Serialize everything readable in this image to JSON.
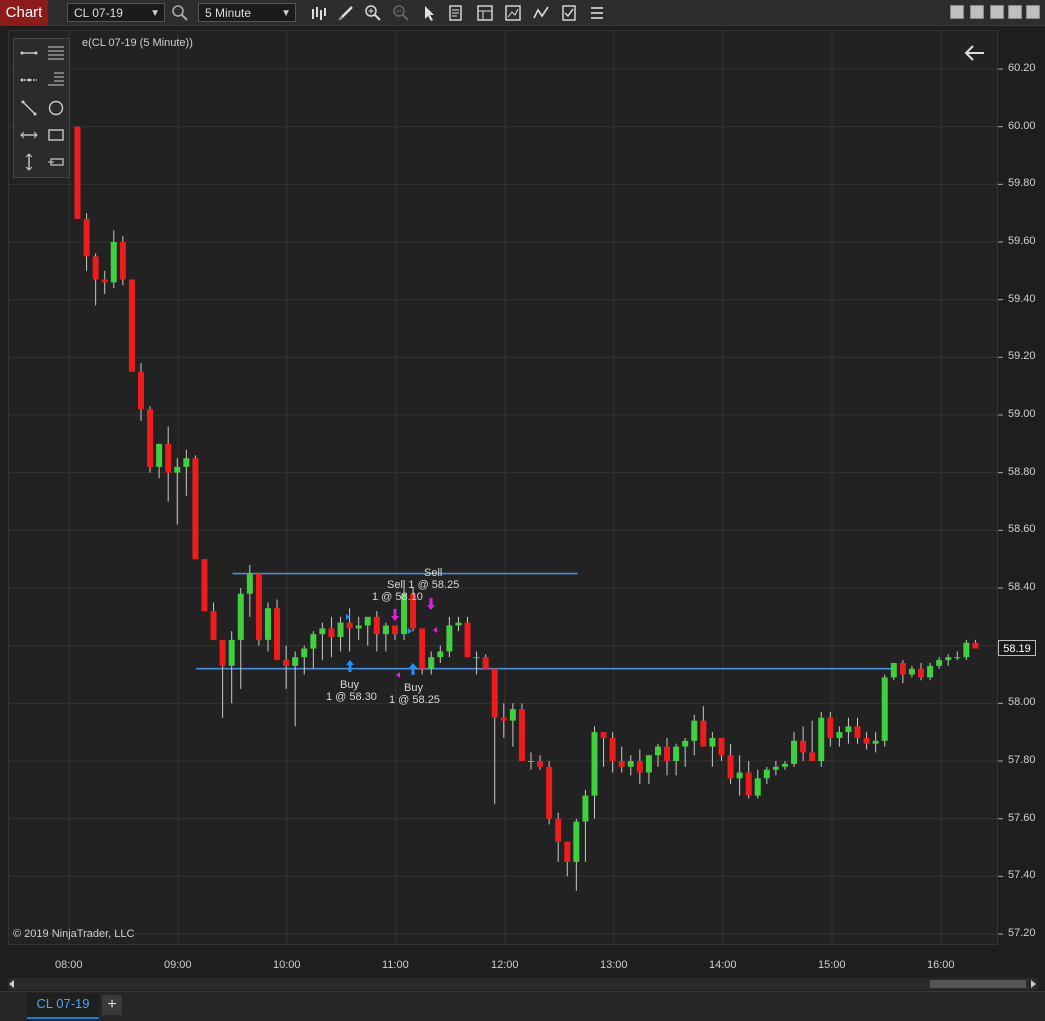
{
  "toolbar": {
    "chart_label": "Chart",
    "instrument": "CL 07-19",
    "timeframe": "5 Minute",
    "icons": [
      "bar-type-icon",
      "draw-tool-icon",
      "zoom-in-icon",
      "zoom-out-icon",
      "pointer-icon",
      "data-box-icon",
      "templates-icon",
      "strategies-icon",
      "indicators-icon",
      "properties-icon",
      "menu-icon"
    ]
  },
  "chart": {
    "title": "e(CL 07-19 (5 Minute))",
    "copyright": "© 2019 NinjaTrader, LLC",
    "last_price": "58.19",
    "y_ticks": [
      "60.20",
      "60.00",
      "59.80",
      "59.60",
      "59.40",
      "59.20",
      "59.00",
      "58.80",
      "58.60",
      "58.40",
      "58.20",
      "58.00",
      "57.80",
      "57.60",
      "57.40",
      "57.20"
    ],
    "x_ticks": [
      "08:00",
      "09:00",
      "10:00",
      "11:00",
      "12:00",
      "13:00",
      "14:00",
      "15:00",
      "16:00"
    ],
    "colors": {
      "up": "#3fcf3f",
      "down": "#ee1c1c",
      "line": "#4d8bdc",
      "buy": "#1e90ff",
      "sell": "#e020e0"
    }
  },
  "annotations": {
    "sell_top": "Sell",
    "sell1": "Sell 1 @ 58.25",
    "sell2": "1 @ 58.10",
    "buy1_a": "Buy",
    "buy1_b": "1 @ 58.30",
    "buy2_a": "Buy",
    "buy2_b": "1 @ 58.25"
  },
  "chart_data": {
    "type": "candlestick",
    "ylim": [
      57.2,
      60.2
    ],
    "x_ticks": [
      "08:00",
      "09:00",
      "10:00",
      "11:00",
      "12:00",
      "13:00",
      "14:00",
      "15:00",
      "16:00"
    ],
    "candles": [
      [
        60.0,
        60.0,
        59.68,
        59.68
      ],
      [
        59.68,
        59.7,
        59.5,
        59.55
      ],
      [
        59.55,
        59.56,
        59.38,
        59.47
      ],
      [
        59.47,
        59.5,
        59.42,
        59.46
      ],
      [
        59.46,
        59.64,
        59.44,
        59.6
      ],
      [
        59.6,
        59.62,
        59.45,
        59.47
      ],
      [
        59.47,
        59.47,
        59.15,
        59.15
      ],
      [
        59.15,
        59.18,
        58.98,
        59.02
      ],
      [
        59.02,
        59.03,
        58.8,
        58.82
      ],
      [
        58.82,
        58.9,
        58.78,
        58.9
      ],
      [
        58.9,
        58.96,
        58.7,
        58.8
      ],
      [
        58.8,
        58.85,
        58.62,
        58.82
      ],
      [
        58.82,
        58.88,
        58.72,
        58.85
      ],
      [
        58.85,
        58.86,
        58.5,
        58.5
      ],
      [
        58.5,
        58.5,
        58.32,
        58.32
      ],
      [
        58.32,
        58.35,
        58.22,
        58.22
      ],
      [
        58.22,
        58.22,
        57.95,
        58.13
      ],
      [
        58.13,
        58.25,
        58.0,
        58.22
      ],
      [
        58.22,
        58.4,
        58.05,
        58.38
      ],
      [
        58.38,
        58.48,
        58.3,
        58.45
      ],
      [
        58.45,
        58.45,
        58.2,
        58.22
      ],
      [
        58.22,
        58.35,
        58.18,
        58.33
      ],
      [
        58.33,
        58.36,
        58.15,
        58.15
      ],
      [
        58.15,
        58.2,
        58.05,
        58.13
      ],
      [
        58.13,
        58.18,
        57.92,
        58.16
      ],
      [
        58.16,
        58.2,
        58.1,
        58.19
      ],
      [
        58.19,
        58.25,
        58.12,
        58.24
      ],
      [
        58.24,
        58.28,
        58.15,
        58.26
      ],
      [
        58.26,
        58.3,
        58.16,
        58.23
      ],
      [
        58.23,
        58.3,
        58.18,
        58.28
      ],
      [
        58.28,
        58.33,
        58.18,
        58.26
      ],
      [
        58.26,
        58.3,
        58.22,
        58.27
      ],
      [
        58.27,
        58.3,
        58.2,
        58.3
      ],
      [
        58.3,
        58.32,
        58.18,
        58.24
      ],
      [
        58.24,
        58.28,
        58.18,
        58.27
      ],
      [
        58.27,
        58.27,
        58.22,
        58.24
      ],
      [
        58.24,
        58.4,
        58.22,
        58.38
      ],
      [
        58.38,
        58.4,
        58.25,
        58.26
      ],
      [
        58.26,
        58.26,
        58.1,
        58.12
      ],
      [
        58.12,
        58.18,
        58.1,
        58.16
      ],
      [
        58.16,
        58.2,
        58.14,
        58.18
      ],
      [
        58.18,
        58.3,
        58.16,
        58.27
      ],
      [
        58.27,
        58.3,
        58.25,
        58.28
      ],
      [
        58.28,
        58.3,
        58.16,
        58.16
      ],
      [
        58.16,
        58.18,
        58.1,
        58.16
      ],
      [
        58.16,
        58.17,
        58.12,
        58.12
      ],
      [
        58.12,
        58.12,
        57.65,
        57.95
      ],
      [
        57.95,
        58.0,
        57.88,
        57.94
      ],
      [
        57.94,
        58.0,
        57.85,
        57.98
      ],
      [
        57.98,
        58.0,
        57.8,
        57.8
      ],
      [
        57.8,
        57.83,
        57.77,
        57.8
      ],
      [
        57.8,
        57.82,
        57.77,
        57.78
      ],
      [
        57.78,
        57.8,
        57.58,
        57.6
      ],
      [
        57.6,
        57.62,
        57.45,
        57.52
      ],
      [
        57.52,
        57.52,
        57.4,
        57.45
      ],
      [
        57.45,
        57.6,
        57.35,
        57.59
      ],
      [
        57.59,
        57.7,
        57.45,
        57.68
      ],
      [
        57.68,
        57.92,
        57.6,
        57.9
      ],
      [
        57.9,
        57.9,
        57.78,
        57.88
      ],
      [
        57.88,
        57.9,
        57.76,
        57.8
      ],
      [
        57.8,
        57.85,
        57.76,
        57.78
      ],
      [
        57.78,
        57.82,
        57.75,
        57.8
      ],
      [
        57.8,
        57.84,
        57.72,
        57.76
      ],
      [
        57.76,
        57.82,
        57.72,
        57.82
      ],
      [
        57.82,
        57.86,
        57.78,
        57.85
      ],
      [
        57.85,
        57.88,
        57.75,
        57.8
      ],
      [
        57.8,
        57.86,
        57.75,
        57.85
      ],
      [
        57.85,
        57.88,
        57.78,
        57.87
      ],
      [
        57.87,
        57.96,
        57.82,
        57.94
      ],
      [
        57.94,
        57.99,
        57.85,
        57.85
      ],
      [
        57.85,
        57.9,
        57.78,
        57.88
      ],
      [
        57.88,
        57.88,
        57.8,
        57.82
      ],
      [
        57.82,
        57.86,
        57.72,
        57.74
      ],
      [
        57.74,
        57.82,
        57.68,
        57.76
      ],
      [
        57.76,
        57.8,
        57.67,
        57.68
      ],
      [
        57.68,
        57.77,
        57.67,
        57.74
      ],
      [
        57.74,
        57.78,
        57.72,
        57.77
      ],
      [
        57.77,
        57.8,
        57.75,
        57.78
      ],
      [
        57.78,
        57.8,
        57.77,
        57.79
      ],
      [
        57.79,
        57.9,
        57.78,
        57.87
      ],
      [
        57.87,
        57.92,
        57.8,
        57.83
      ],
      [
        57.83,
        57.94,
        57.8,
        57.8
      ],
      [
        57.8,
        57.97,
        57.78,
        57.95
      ],
      [
        57.95,
        57.97,
        57.85,
        57.88
      ],
      [
        57.88,
        57.92,
        57.85,
        57.9
      ],
      [
        57.9,
        57.95,
        57.86,
        57.92
      ],
      [
        57.92,
        57.95,
        57.86,
        57.88
      ],
      [
        57.88,
        57.9,
        57.84,
        57.86
      ],
      [
        57.86,
        57.9,
        57.83,
        57.87
      ],
      [
        57.87,
        58.1,
        57.85,
        58.09
      ],
      [
        58.09,
        58.14,
        58.08,
        58.14
      ],
      [
        58.14,
        58.15,
        58.07,
        58.1
      ],
      [
        58.1,
        58.13,
        58.09,
        58.12
      ],
      [
        58.12,
        58.14,
        58.08,
        58.09
      ],
      [
        58.09,
        58.14,
        58.08,
        58.13
      ],
      [
        58.13,
        58.16,
        58.12,
        58.15
      ],
      [
        58.15,
        58.17,
        58.13,
        58.16
      ],
      [
        58.16,
        58.18,
        58.15,
        58.16
      ],
      [
        58.16,
        58.22,
        58.15,
        58.21
      ],
      [
        58.21,
        58.22,
        58.19,
        58.19
      ]
    ],
    "lines": [
      {
        "from": [
          "09:30",
          58.45
        ],
        "to": [
          "12:40",
          58.45
        ]
      },
      {
        "from": [
          "09:10",
          58.12
        ],
        "to": [
          "15:35",
          58.12
        ]
      }
    ]
  }
}
